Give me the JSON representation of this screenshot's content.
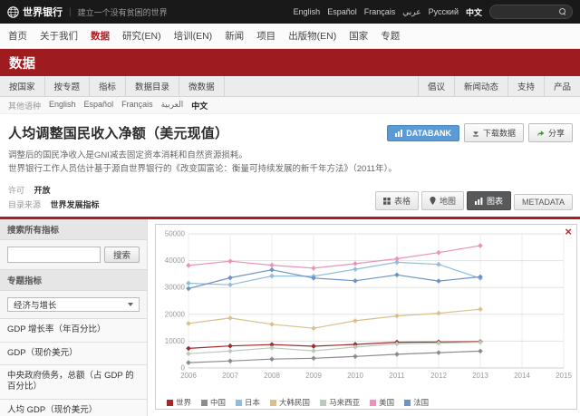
{
  "header": {
    "logo": "世界银行",
    "tagline": "建立一个没有贫困的世界",
    "languages": [
      "English",
      "Español",
      "Français",
      "عربي",
      "Русский",
      "中文"
    ]
  },
  "nav": {
    "items": [
      "首页",
      "关于我们",
      "数据",
      "研究(EN)",
      "培训(EN)",
      "新闻",
      "项目",
      "出版物(EN)",
      "国家",
      "专题"
    ],
    "active": "数据"
  },
  "banner": {
    "title": "数据"
  },
  "subnav": {
    "left": [
      "按国家",
      "按专题",
      "指标",
      "数据目录",
      "微数据"
    ],
    "right": [
      "倡议",
      "新闻动态",
      "支持",
      "产品"
    ]
  },
  "lang_row": {
    "label": "其他语种",
    "items": [
      "English",
      "Español",
      "Français",
      "العربية",
      "中文"
    ]
  },
  "page": {
    "title": "人均调整国民收入净额（美元现值）",
    "databank_label": "DATABANK",
    "download_label": "下载数据",
    "share_label": "分享",
    "description1": "调整后的国民净收入是GNI减去固定资本消耗和自然资源损耗。",
    "description2": "世界银行工作人员估计基于源自世界银行的《改变国富论：衡量可持续发展的新千年方法》（2011年）。",
    "license_label": "许可",
    "license_value": "开放",
    "catalog_label": "目录来源",
    "catalog_value": "世界发展指标",
    "tabs": [
      {
        "id": "table",
        "label": "表格"
      },
      {
        "id": "map",
        "label": "地图"
      },
      {
        "id": "chart",
        "label": "图表"
      },
      {
        "id": "metadata",
        "label": "METADATA"
      }
    ],
    "active_tab": "chart"
  },
  "sidebar": {
    "search_header": "搜索所有指标",
    "search_button": "搜索",
    "topic_header": "专题指标",
    "topic_dropdown": "经济与增长",
    "indicators": [
      "GDP 增长率（年百分比）",
      "GDP（现价美元）",
      "中央政府债务，总额（占 GDP 的百分比）",
      "人均 GDP（现价美元）"
    ]
  },
  "chart_data": {
    "type": "line",
    "title": "人均调整国民收入净额（美元现值）",
    "x": [
      2006,
      2007,
      2008,
      2009,
      2010,
      2011,
      2012,
      2013
    ],
    "xticks": [
      2006,
      2007,
      2008,
      2009,
      2010,
      2011,
      2012,
      2013,
      2014,
      2015
    ],
    "xlim": [
      2006,
      2015
    ],
    "ylim": [
      0,
      50000
    ],
    "yticks": [
      0,
      10000,
      20000,
      30000,
      40000,
      50000
    ],
    "grid": true,
    "legend_position": "bottom",
    "series": [
      {
        "name": "世界",
        "color": "#a02c2a",
        "values": [
          7300,
          8200,
          8700,
          8100,
          8800,
          9600,
          9700,
          9800
        ]
      },
      {
        "name": "中国",
        "color": "#8c8c8c",
        "values": [
          2000,
          2600,
          3300,
          3600,
          4300,
          5100,
          5700,
          6300
        ]
      },
      {
        "name": "日本",
        "color": "#92bcd8",
        "values": [
          31600,
          31000,
          34300,
          34200,
          36800,
          39400,
          38600,
          33400
        ]
      },
      {
        "name": "大韩民国",
        "color": "#d9c18a",
        "values": [
          16600,
          18600,
          16300,
          14800,
          17600,
          19400,
          20400,
          21900
        ]
      },
      {
        "name": "马来西亚",
        "color": "#bccabc",
        "values": [
          5300,
          6300,
          7500,
          6400,
          7800,
          9000,
          9300,
          9600
        ]
      },
      {
        "name": "美国",
        "color": "#e994b8",
        "values": [
          38200,
          39800,
          38300,
          37200,
          38900,
          40700,
          43000,
          45600
        ]
      },
      {
        "name": "法国",
        "color": "#6b93c4",
        "values": [
          29600,
          33600,
          36600,
          33500,
          32500,
          34700,
          32400,
          34000
        ]
      }
    ]
  }
}
